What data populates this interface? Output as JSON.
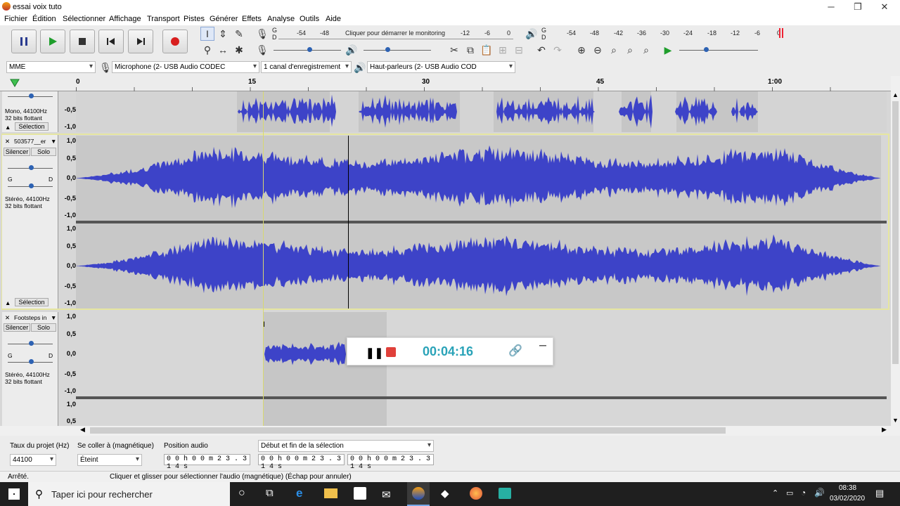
{
  "window": {
    "title": "essai voix tuto"
  },
  "menu": [
    "Fichier",
    "Édition",
    "Sélectionner",
    "Affichage",
    "Transport",
    "Pistes",
    "Générer",
    "Effets",
    "Analyse",
    "Outils",
    "Aide"
  ],
  "meters": {
    "rec_label": "Cliquer pour démarrer le monitoring",
    "rec_scale": [
      "-54",
      "-48",
      "-12",
      "-6",
      "0"
    ],
    "play_scale": [
      "-54",
      "-48",
      "-42",
      "-36",
      "-30",
      "-24",
      "-18",
      "-12",
      "-6",
      "0"
    ],
    "gd": [
      "G",
      "D"
    ]
  },
  "device": {
    "host": "MME",
    "input": "Microphone (2- USB Audio CODEC",
    "channels": "1 canal d'enregistrement",
    "output": "Haut-parleurs (2- USB Audio COD"
  },
  "ruler": {
    "ticks": [
      "0",
      "15",
      "30",
      "45",
      "1:00"
    ]
  },
  "tracks": [
    {
      "info1": "Mono, 44100Hz",
      "info2": "32 bits flottant",
      "select": "Sélection",
      "scale": [
        "-0,5",
        "-1,0"
      ]
    },
    {
      "name": "503577__er",
      "mute": "Silencer",
      "solo": "Solo",
      "info1": "Stéréo, 44100Hz",
      "info2": "32 bits flottant",
      "select": "Sélection",
      "scale1": [
        "1,0",
        "0,5",
        "0,0",
        "-0,5",
        "-1,0"
      ],
      "scale2": [
        "1,0",
        "0,5",
        "0,0",
        "-0,5",
        "-1,0"
      ],
      "g": "G",
      "d": "D"
    },
    {
      "name": "Footsteps in",
      "mute": "Silencer",
      "solo": "Solo",
      "info1": "Stéréo, 44100Hz",
      "info2": "32 bits flottant",
      "scale1": [
        "1,0",
        "0,5",
        "0,0",
        "-0,5",
        "-1,0"
      ],
      "scale2": [
        "1,0",
        "0,5"
      ],
      "g": "G",
      "d": "D"
    }
  ],
  "recorder": {
    "time": "00:04:16"
  },
  "selection_bar": {
    "rate_label": "Taux du projet (Hz)",
    "rate_value": "44100",
    "snap_label": "Se coller à (magnétique)",
    "snap_value": "Éteint",
    "pos_label": "Position audio",
    "sel_label": "Début et fin de la sélection",
    "pos_value": "0 0 h 0 0 m 2 3 . 3 1 4 s",
    "start_value": "0 0 h 0 0 m 2 3 . 3 1 4 s",
    "end_value": "0 0 h 0 0 m 2 3 . 3 1 4 s"
  },
  "status": {
    "state": "Arrêté.",
    "hint": "Cliquer et glisser pour sélectionner l'audio (magnétique) (Échap pour annuler)"
  },
  "taskbar": {
    "search": "Taper ici pour rechercher",
    "time": "08:38",
    "date": "03/02/2020"
  }
}
